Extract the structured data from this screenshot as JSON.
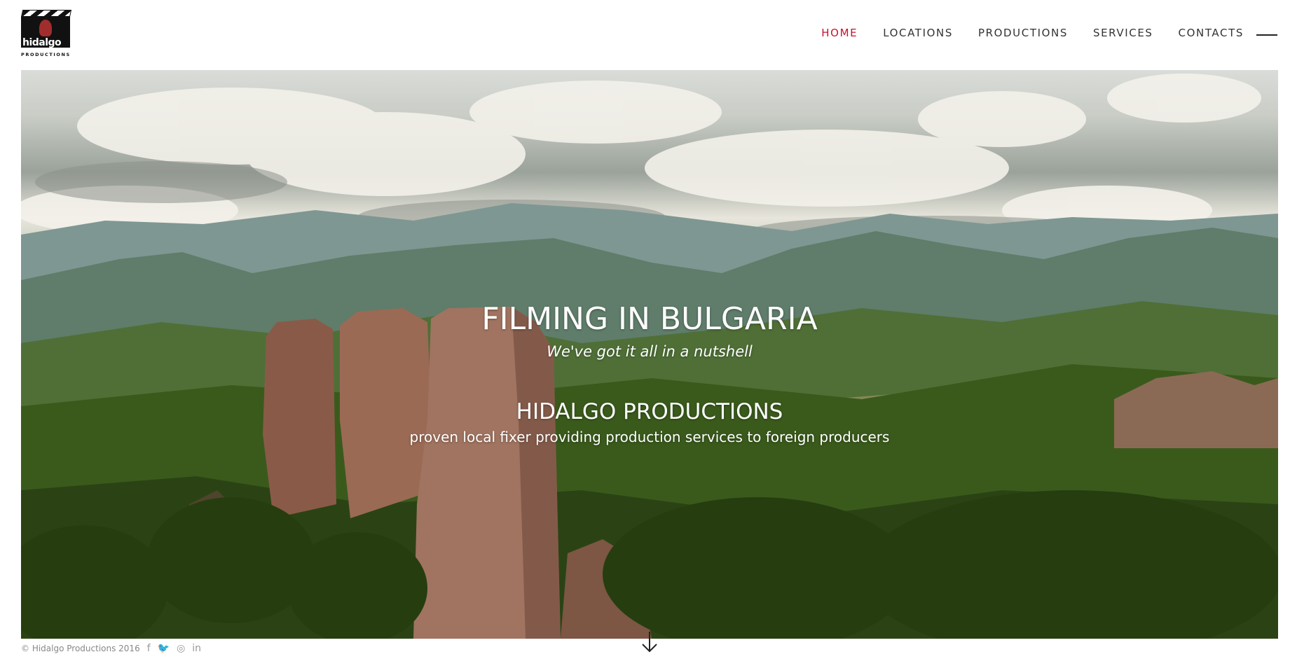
{
  "header": {
    "logo_word": "hidalgo",
    "logo_sub": "PRODUCTIONS",
    "nav": [
      {
        "label": "HOME",
        "active": true
      },
      {
        "label": "LOCATIONS",
        "active": false
      },
      {
        "label": "PRODUCTIONS",
        "active": false
      },
      {
        "label": "SERVICES",
        "active": false
      },
      {
        "label": "CONTACTS",
        "active": false
      }
    ],
    "menu_icon": "hamburger-line-icon",
    "active_color": "#c8102e"
  },
  "hero": {
    "title": "FILMING IN BULGARIA",
    "tagline": "We've got it all in a nutshell",
    "subtitle": "HIDALGO PRODUCTIONS",
    "description": "proven local fixer providing production services to foreign producers"
  },
  "footer": {
    "copyright": "© Hidalgo Productions 2016",
    "social": [
      {
        "name": "facebook-icon",
        "glyph": "f"
      },
      {
        "name": "twitter-icon",
        "glyph": "🐦"
      },
      {
        "name": "instagram-icon",
        "glyph": "◎"
      },
      {
        "name": "linkedin-icon",
        "glyph": "in"
      }
    ]
  },
  "scroll": {
    "icon": "arrow-down-icon"
  }
}
